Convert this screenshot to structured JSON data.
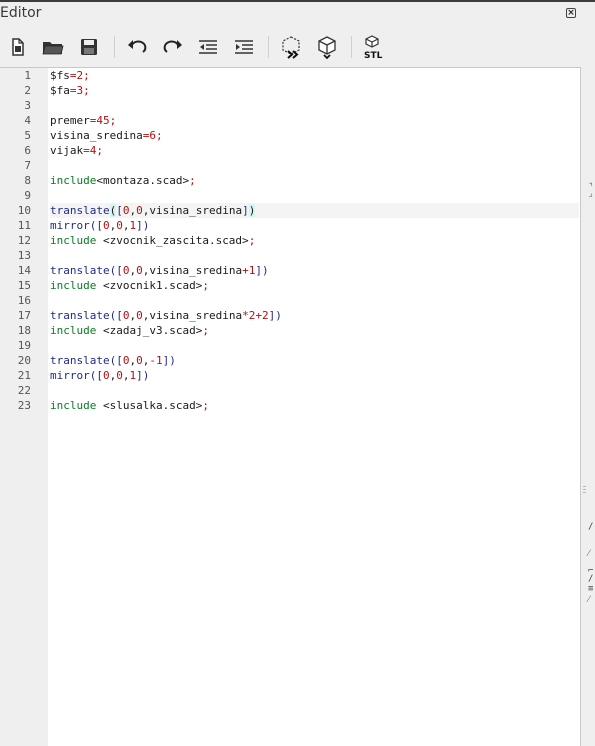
{
  "window": {
    "title": "Editor",
    "close_glyph": "×"
  },
  "toolbar": {
    "buttons": [
      {
        "icon": "new-file-icon"
      },
      {
        "icon": "open-folder-icon"
      },
      {
        "icon": "save-icon"
      },
      {
        "icon": "undo-icon"
      },
      {
        "icon": "redo-icon"
      },
      {
        "icon": "unindent-icon"
      },
      {
        "icon": "indent-icon"
      },
      {
        "icon": "preview-icon"
      },
      {
        "icon": "render-icon"
      },
      {
        "icon": "export-stl-icon",
        "label": "STL"
      }
    ]
  },
  "editor": {
    "line_numbers": [
      "1",
      "2",
      "3",
      "4",
      "5",
      "6",
      "7",
      "8",
      "9",
      "10",
      "11",
      "12",
      "13",
      "14",
      "15",
      "16",
      "17",
      "18",
      "19",
      "20",
      "21",
      "22",
      "23"
    ],
    "current_line": 10,
    "lines": [
      [
        [
          "",
          "$fs"
        ],
        [
          "op",
          "="
        ],
        [
          "num",
          "2"
        ],
        [
          "op",
          ";"
        ]
      ],
      [
        [
          "",
          "$fa"
        ],
        [
          "op",
          "="
        ],
        [
          "num",
          "3"
        ],
        [
          "op",
          ";"
        ]
      ],
      [],
      [
        [
          "",
          "premer"
        ],
        [
          "op",
          "="
        ],
        [
          "num",
          "45"
        ],
        [
          "op",
          ";"
        ]
      ],
      [
        [
          "",
          "visina_sredina"
        ],
        [
          "op",
          "="
        ],
        [
          "num",
          "6"
        ],
        [
          "op",
          ";"
        ]
      ],
      [
        [
          "",
          "vijak"
        ],
        [
          "op",
          "="
        ],
        [
          "num",
          "4"
        ],
        [
          "op",
          ";"
        ]
      ],
      [],
      [
        [
          "kw",
          "include"
        ],
        [
          "",
          "<montaza.scad>"
        ],
        [
          "op",
          ";"
        ]
      ],
      [],
      [
        [
          "fn",
          "translate"
        ],
        [
          "match",
          "("
        ],
        [
          "brk",
          "["
        ],
        [
          "num",
          "0"
        ],
        [
          "",
          ","
        ],
        [
          "num",
          "0"
        ],
        [
          "",
          ",visina_sredina"
        ],
        [
          "brk",
          "]"
        ],
        [
          "match",
          ")"
        ]
      ],
      [
        [
          "fn",
          "mirror"
        ],
        [
          "brk",
          "(["
        ],
        [
          "num",
          "0"
        ],
        [
          "",
          ","
        ],
        [
          "num",
          "0"
        ],
        [
          "",
          ","
        ],
        [
          "num",
          "1"
        ],
        [
          "brk",
          "])"
        ]
      ],
      [
        [
          "kw",
          "include"
        ],
        [
          "",
          " <zvocnik_zascita.scad>"
        ],
        [
          "op",
          ";"
        ]
      ],
      [],
      [
        [
          "fn",
          "translate"
        ],
        [
          "brk",
          "(["
        ],
        [
          "num",
          "0"
        ],
        [
          "",
          ","
        ],
        [
          "num",
          "0"
        ],
        [
          "",
          ",visina_sredina"
        ],
        [
          "op",
          "+"
        ],
        [
          "num",
          "1"
        ],
        [
          "brk",
          "])"
        ]
      ],
      [
        [
          "kw",
          "include"
        ],
        [
          "",
          " <zvocnik1.scad>"
        ],
        [
          "op",
          ";"
        ]
      ],
      [],
      [
        [
          "fn",
          "translate"
        ],
        [
          "brk",
          "(["
        ],
        [
          "num",
          "0"
        ],
        [
          "",
          ","
        ],
        [
          "num",
          "0"
        ],
        [
          "",
          ",visina_sredina"
        ],
        [
          "op",
          "*"
        ],
        [
          "num",
          "2"
        ],
        [
          "op",
          "+"
        ],
        [
          "num",
          "2"
        ],
        [
          "brk",
          "])"
        ]
      ],
      [
        [
          "kw",
          "include"
        ],
        [
          "",
          " <zadaj_v3.scad>"
        ],
        [
          "op",
          ";"
        ]
      ],
      [],
      [
        [
          "fn",
          "translate"
        ],
        [
          "brk",
          "(["
        ],
        [
          "num",
          "0"
        ],
        [
          "",
          ","
        ],
        [
          "num",
          "0"
        ],
        [
          "",
          ","
        ],
        [
          "op",
          "-"
        ],
        [
          "num",
          "1"
        ],
        [
          "brk",
          "])"
        ]
      ],
      [
        [
          "fn",
          "mirror"
        ],
        [
          "brk",
          "(["
        ],
        [
          "num",
          "0"
        ],
        [
          "",
          ","
        ],
        [
          "num",
          "0"
        ],
        [
          "",
          ","
        ],
        [
          "num",
          "1"
        ],
        [
          "brk",
          "])"
        ]
      ],
      [],
      [
        [
          "kw",
          "include"
        ],
        [
          "",
          " <slusalka.scad>"
        ],
        [
          "op",
          ";"
        ]
      ]
    ]
  },
  "side_fragments": [
    {
      "text": "⌝"
    },
    {
      "text": "⌟"
    },
    {
      "text": "/"
    },
    {
      "text": "⁄"
    },
    {
      "text": "⌐"
    },
    {
      "text": "/"
    },
    {
      "text": "≡"
    },
    {
      "text": "⁄"
    }
  ]
}
